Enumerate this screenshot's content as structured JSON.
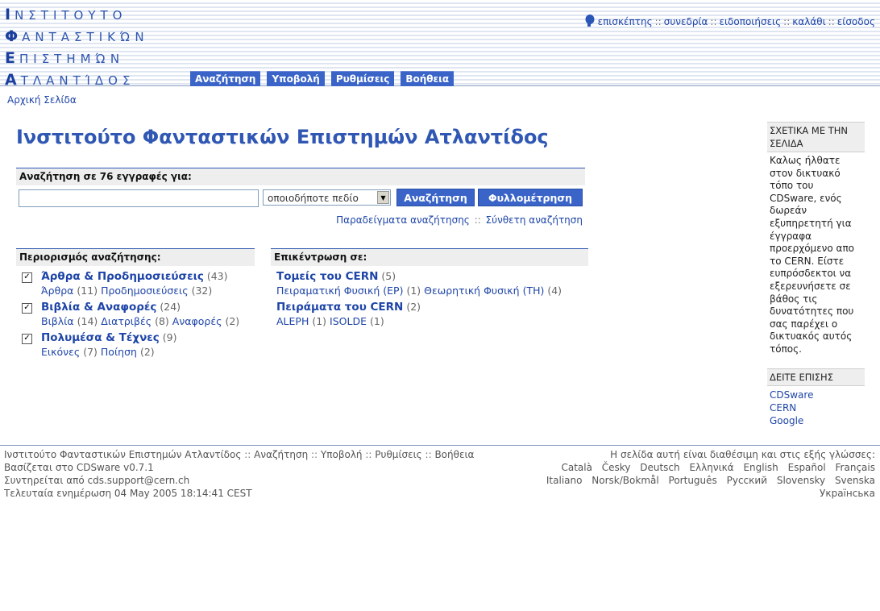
{
  "header": {
    "logo": [
      {
        "first": "Ι",
        "rest": "ΝΣΤΙΤΟΥΤΟ"
      },
      {
        "first": "Φ",
        "rest": "ΑΝΤΑΣΤΙΚΏΝ"
      },
      {
        "first": "Ε",
        "rest": "ΠΙΣΤΗΜΏΝ"
      },
      {
        "first": "Α",
        "rest": "ΤΛΑΝΤΊΔΟΣ"
      }
    ],
    "user_menu": [
      "επισκέπτης",
      "συνεδρία",
      "ειδοποιήσεις",
      "καλάθι",
      "είσοδος"
    ],
    "user_menu_separator": "::",
    "tabs": [
      "Αναζήτηση",
      "Υποβολή",
      "Ρυθμίσεις",
      "Βοήθεια"
    ]
  },
  "breadcrumb": "Αρχική Σελίδα",
  "page_title": "Ινστιτούτο Φανταστικών Επιστημών Ατλαντίδος",
  "search": {
    "heading": "Αναζήτηση σε 76 εγγραφές για:",
    "input_value": "",
    "field_select": "οποιοδήποτε πεδίο",
    "search_button": "Αναζήτηση",
    "browse_button": "Φυλλομέτρηση",
    "examples_link": "Παραδείγματα αναζήτησης",
    "links_separator": "::",
    "advanced_link": "Σύνθετη αναζήτηση"
  },
  "narrow": {
    "heading": "Περιορισμός αναζήτησης:",
    "collections": [
      {
        "name": "Άρθρα & Προδημοσιεύσεις",
        "count": "(43)",
        "checked": true,
        "sub": [
          {
            "name": "Άρθρα",
            "count": "(11)"
          },
          {
            "name": "Προδημοσιεύσεις",
            "count": "(32)"
          }
        ]
      },
      {
        "name": "Βιβλία & Αναφορές",
        "count": "(24)",
        "checked": true,
        "sub": [
          {
            "name": "Βιβλία",
            "count": "(14)"
          },
          {
            "name": "Διατριβές",
            "count": "(8)"
          },
          {
            "name": "Αναφορές",
            "count": "(2)"
          }
        ]
      },
      {
        "name": "Πολυμέσα & Τέχνες",
        "count": "(9)",
        "checked": true,
        "sub": [
          {
            "name": "Εικόνες",
            "count": "(7)"
          },
          {
            "name": "Ποίηση",
            "count": "(2)"
          }
        ]
      }
    ]
  },
  "focus": {
    "heading": "Επικέντρωση σε:",
    "collections": [
      {
        "name": "Τομείς του CERN",
        "count": "(5)",
        "sub": [
          {
            "name": "Πειραματική Φυσική (EP)",
            "count": "(1)"
          },
          {
            "name": "Θεωρητική Φυσική (TH)",
            "count": "(4)"
          }
        ]
      },
      {
        "name": "Πειράματα του CERN",
        "count": "(2)",
        "sub": [
          {
            "name": "ALEPH",
            "count": "(1)"
          },
          {
            "name": "ISOLDE",
            "count": "(1)"
          }
        ]
      }
    ]
  },
  "sidebar": {
    "about_heading": "ΣΧΕΤΙΚΑ ΜΕ ΤΗΝ ΣΕΛΙΔΑ",
    "about_text": "Καλως ήλθατε στον δικτυακό τόπο του CDSware, ενός δωρεάν εξυπηρετητή για έγγραφα προερχόμενο απο το CERN. Είστε ευπρόσδεκτοι να εξερευνήσετε σε βάθος τις δυνατότητες που σας παρέχει ο δικτυακός αυτός τόπος.",
    "see_also_heading": "ΔΕΙΤΕ ΕΠΙΣΗΣ",
    "see_also_links": [
      "CDSware",
      "CERN",
      "Google"
    ]
  },
  "footer": {
    "nav": [
      "Ινστιτούτο Φανταστικών Επιστημών Ατλαντίδος",
      "Αναζήτηση",
      "Υποβολή",
      "Ρυθμίσεις",
      "Βοήθεια"
    ],
    "separator": "::",
    "powered": "Βασίζεται στο CDSware v0.7.1",
    "maintained": "Συντηρείται από cds.support@cern.ch",
    "updated": "Τελευταία ενημέρωση 04 May 2005 18:14:41 CEST",
    "languages_label": "Η σελίδα αυτή είναι διαθέσιμη και στις εξής γλώσσες:",
    "languages": [
      "Català",
      "Česky",
      "Deutsch",
      "Ελληνικά",
      "English",
      "Español",
      "Français",
      "Italiano",
      "Norsk/Bokmål",
      "Português",
      "Русский",
      "Slovensky",
      "Svenska",
      "Українська"
    ]
  },
  "colors": {
    "accent": "#2f57b3",
    "tab_bg": "#3a64c7",
    "link": "#1e45a8",
    "box_head_bg": "#eeeeee"
  },
  "icons": {
    "user": "head-silhouette-icon",
    "checkbox": "checkmark-icon",
    "select_arrow": "chevron-down-icon"
  }
}
